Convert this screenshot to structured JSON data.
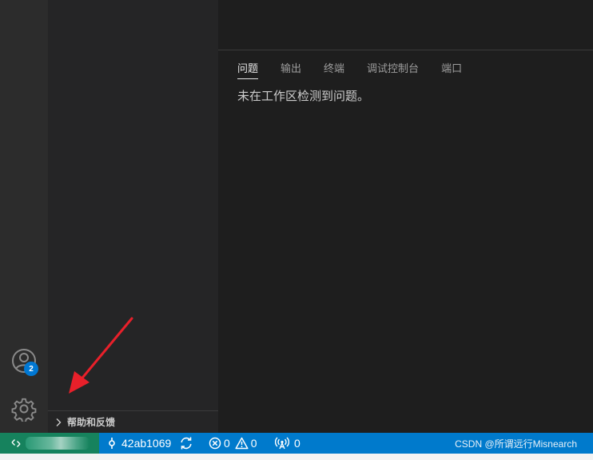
{
  "activity_bar": {
    "accounts_icon": "account-icon",
    "accounts_badge": "2",
    "settings_icon": "gear-icon"
  },
  "sidebar": {
    "section_label": "帮助和反馈",
    "section_icon": "chevron-right-icon"
  },
  "panel": {
    "tabs": [
      {
        "label": "问题",
        "active": true
      },
      {
        "label": "输出",
        "active": false
      },
      {
        "label": "终端",
        "active": false
      },
      {
        "label": "调试控制台",
        "active": false
      },
      {
        "label": "端口",
        "active": false
      }
    ],
    "message": "未在工作区检测到问题。"
  },
  "status_bar": {
    "remote_icon": "remote-icon",
    "branch_icon": "git-commit-icon",
    "branch": "42ab1069",
    "sync_icon": "sync-icon",
    "errors": "0",
    "warnings": "0",
    "ports_icon": "broadcast-icon",
    "ports": "0",
    "watermark": "CSDN @所谓远行Misnearch"
  },
  "colors": {
    "status_bar": "#007acc",
    "remote": "#16825d",
    "badge": "#0078d4",
    "annotation_arrow": "#e8202a"
  }
}
